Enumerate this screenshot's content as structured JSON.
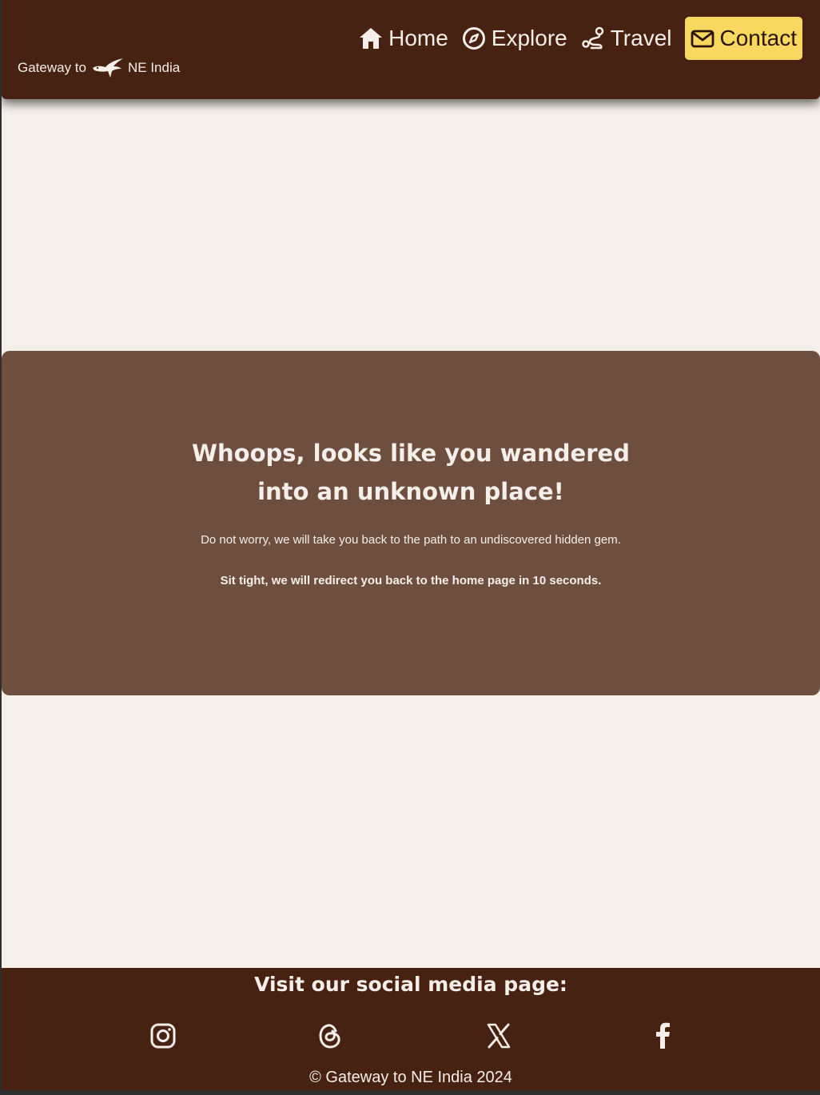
{
  "header": {
    "logo": {
      "prefix": "Gateway to",
      "suffix": "NE India",
      "icon": "hornbill-bird-icon"
    },
    "nav": [
      {
        "label": "Home",
        "icon": "home-icon"
      },
      {
        "label": "Explore",
        "icon": "compass-icon"
      },
      {
        "label": "Travel",
        "icon": "route-icon"
      },
      {
        "label": "Contact",
        "icon": "envelope-icon"
      }
    ]
  },
  "main": {
    "title": "Whoops, looks like you wandered into an unknown place!",
    "message": "Do not worry, we will take you back to the path to an undiscovered hidden gem.",
    "redirect_note": "Sit tight, we will redirect you back to the home page in 10 seconds."
  },
  "footer": {
    "heading": "Visit our social media page:",
    "social": [
      {
        "name": "instagram-icon"
      },
      {
        "name": "threads-icon"
      },
      {
        "name": "x-icon"
      },
      {
        "name": "facebook-icon"
      }
    ],
    "copyright": "© Gateway to NE India 2024"
  },
  "colors": {
    "header_bg": "#472112",
    "page_bg": "#f4efe9",
    "card_bg": "#6d4e3f",
    "accent": "#f9d85f",
    "text_light": "#f4efe9"
  }
}
